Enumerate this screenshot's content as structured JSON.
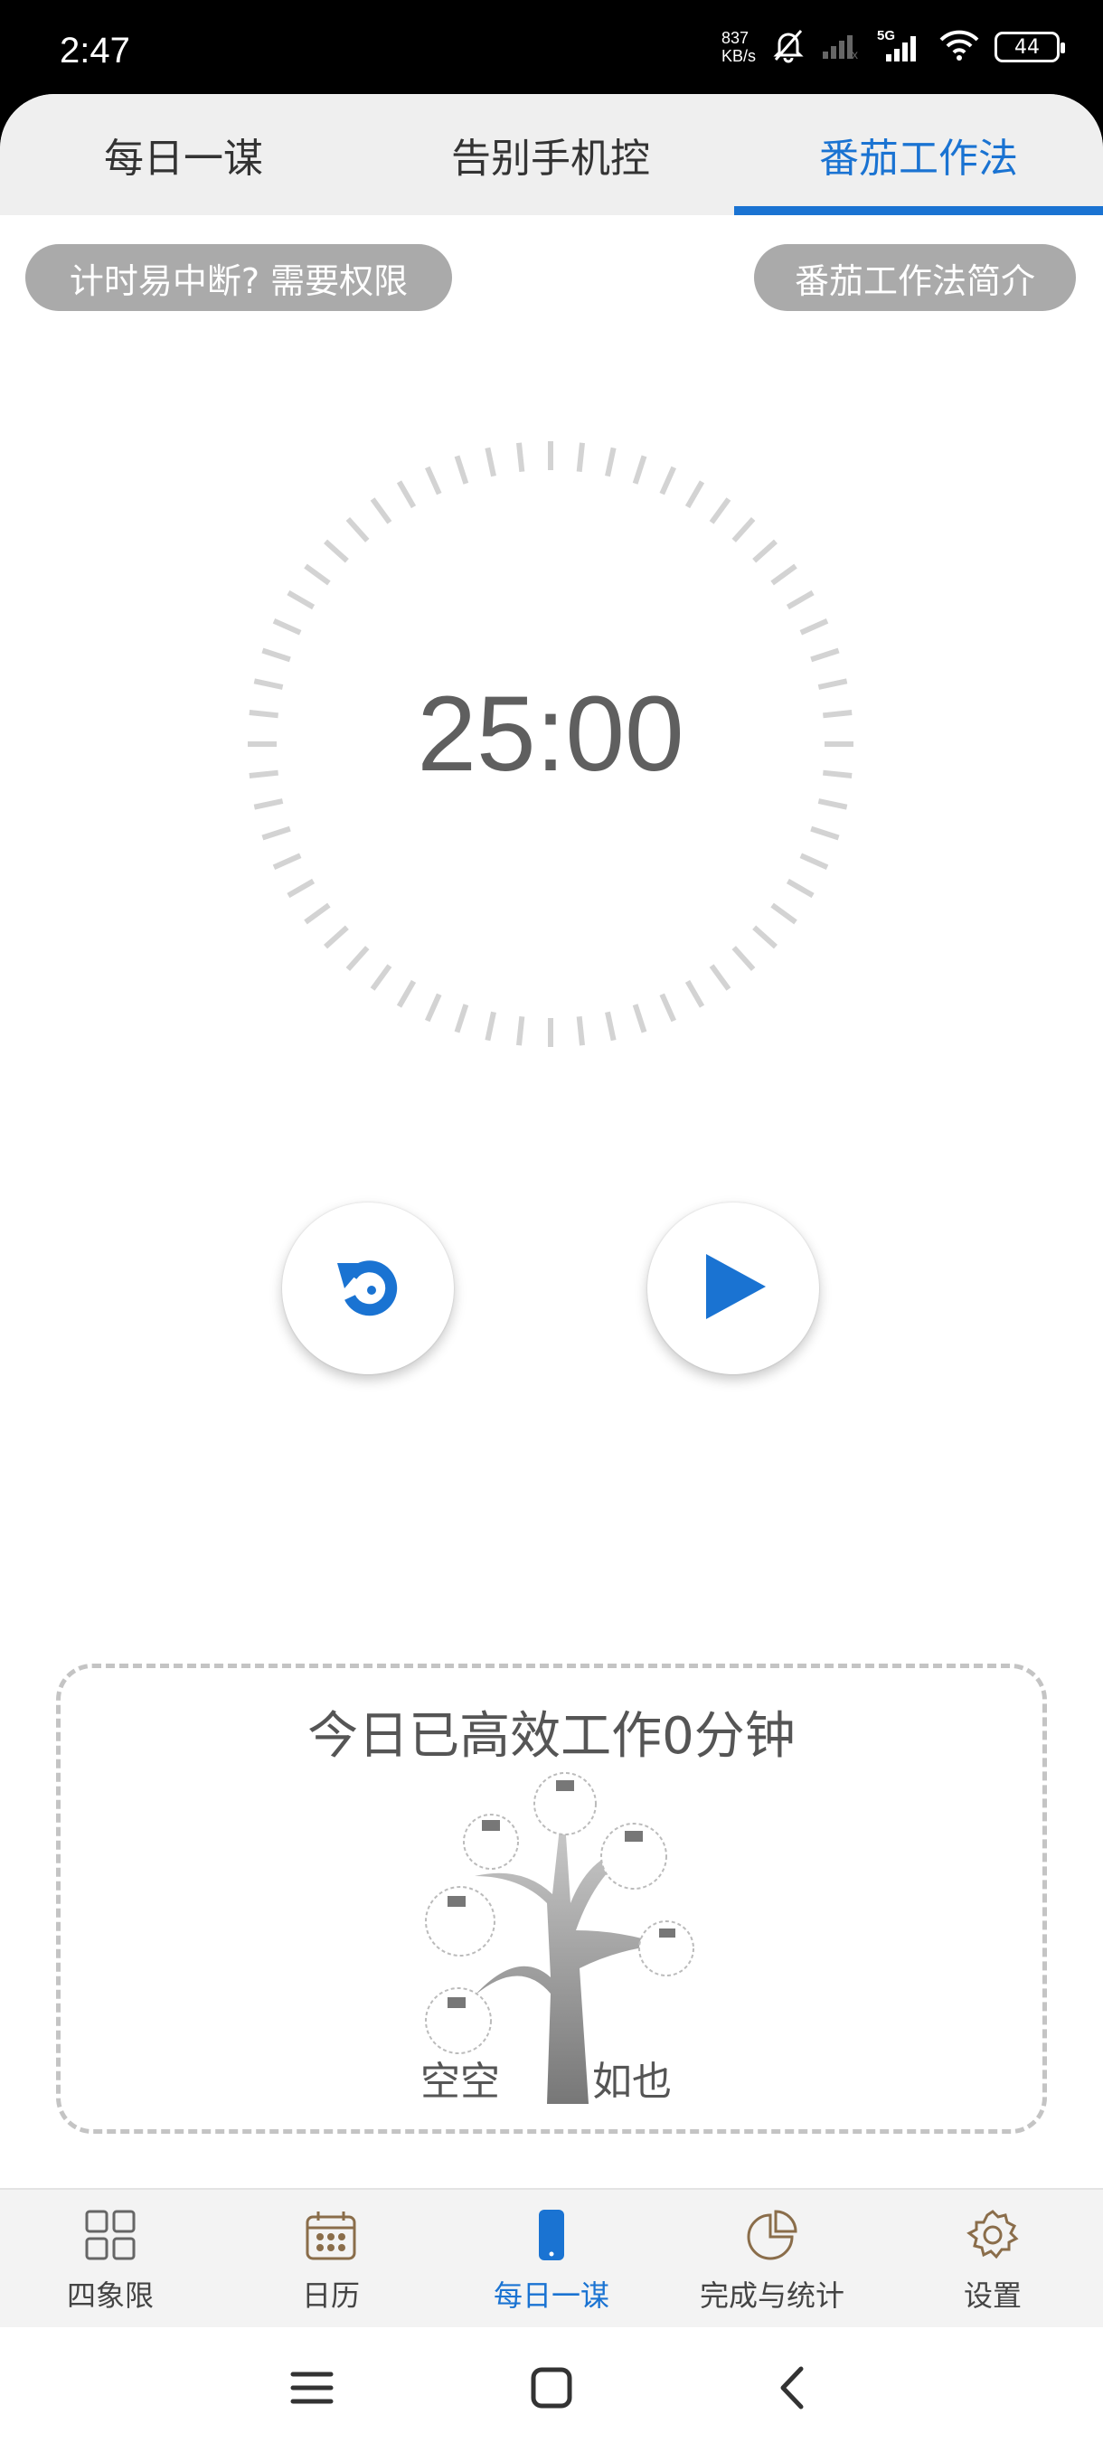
{
  "status": {
    "time": "2:47",
    "net_speed_value": "837",
    "net_speed_unit": "KB/s",
    "network": "5G",
    "battery": "44"
  },
  "tabs": [
    {
      "label": "每日一谋",
      "active": false
    },
    {
      "label": "告别手机控",
      "active": false
    },
    {
      "label": "番茄工作法",
      "active": true
    }
  ],
  "actions": {
    "permission_label": "计时易中断? 需要权限",
    "intro_label": "番茄工作法简介"
  },
  "timer": {
    "display": "25:00"
  },
  "controls": {
    "reset_icon": "reset-icon",
    "play_icon": "play-icon"
  },
  "stats": {
    "today_text": "今日已高效工作0分钟",
    "tree_caption": "空空如也"
  },
  "bottom_nav": [
    {
      "label": "四象限",
      "icon": "grid-icon",
      "active": false
    },
    {
      "label": "日历",
      "icon": "calendar-icon",
      "active": false
    },
    {
      "label": "每日一谋",
      "icon": "phone-icon",
      "active": true
    },
    {
      "label": "完成与统计",
      "icon": "pie-chart-icon",
      "active": false
    },
    {
      "label": "设置",
      "icon": "gear-icon",
      "active": false
    }
  ],
  "colors": {
    "accent": "#1a73d2",
    "pill_bg": "#aaaaaa",
    "tick_color": "#d3d3d3"
  }
}
